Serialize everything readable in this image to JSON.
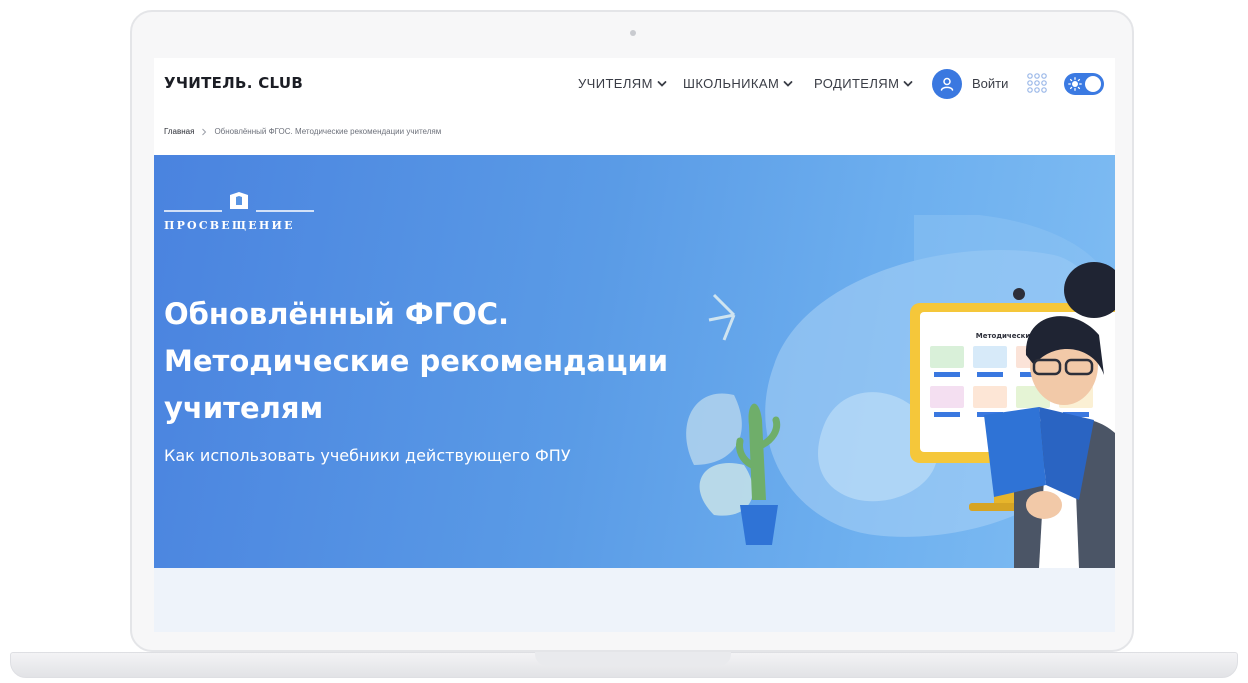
{
  "header": {
    "logo": "УЧИТЕЛЬ. CLUB",
    "nav": [
      {
        "label": "УЧИТЕЛЯМ"
      },
      {
        "label": "ШКОЛЬНИКАМ"
      },
      {
        "label": "РОДИТЕЛЯМ"
      }
    ],
    "login_label": "Войти"
  },
  "breadcrumb": {
    "home": "Главная",
    "current": "Обновлённый ФГОС. Методические рекомендации учителям"
  },
  "banner": {
    "brand": "ПРОСВЕЩЕНИЕ",
    "title_lines": [
      "Обновлённый ФГОС.",
      "Методические рекомендации",
      "учителям"
    ],
    "subtitle": "Как использовать учебники действующего ФПУ",
    "monitor_heading": "Методические письма"
  },
  "colors": {
    "accent": "#3b7ae2",
    "banner_start": "#4a83df",
    "banner_end": "#80bdf3",
    "monitor_frame": "#f5c73a"
  },
  "icons": [
    "chevron-down-icon",
    "user-icon",
    "apps-grid-icon",
    "sun-icon",
    "breadcrumb-separator-icon",
    "prosveshchenie-emblem-icon"
  ]
}
